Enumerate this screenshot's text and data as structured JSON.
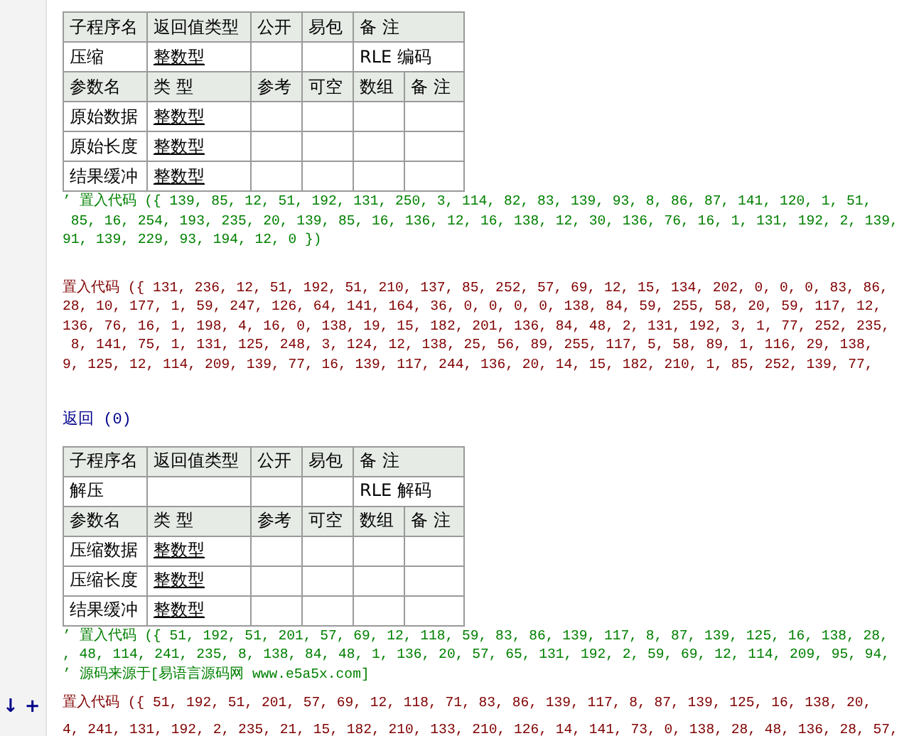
{
  "blocks": [
    {
      "kind": "table",
      "header": [
        "子程序名",
        "返回值类型",
        "公开",
        "易包",
        "备 注"
      ],
      "sub": {
        "name": "压缩",
        "return_type": "整数型",
        "remark": "RLE 编码"
      },
      "param_header": [
        "参数名",
        "类 型",
        "参考",
        "可空",
        "数组",
        "备 注"
      ],
      "params": [
        {
          "name": "原始数据",
          "type": "整数型"
        },
        {
          "name": "原始长度",
          "type": "整数型"
        },
        {
          "name": "结果缓冲",
          "type": "整数型"
        }
      ]
    },
    {
      "kind": "comment",
      "text": "’ 置入代码 ({ 139, 85, 12, 51, 192, 131, 250, 3, 114, 82, 83, 139, 93, 8, 86, 87, 141, 120, 1, 51,"
    },
    {
      "kind": "comment",
      "text": " 85, 16, 254, 193, 235, 20, 139, 85, 16, 136, 12, 16, 138, 12, 30, 136, 76, 16, 1, 131, 192, 2, 139,"
    },
    {
      "kind": "comment",
      "text": "91, 139, 229, 93, 194, 12, 0 })"
    },
    {
      "kind": "blank"
    },
    {
      "kind": "code",
      "text": "置入代码 ({ 131, 236, 12, 51, 192, 51, 210, 137, 85, 252, 57, 69, 12, 15, 134, 202, 0, 0, 0, 83, 86,"
    },
    {
      "kind": "code",
      "text": "28, 10, 177, 1, 59, 247, 126, 64, 141, 164, 36, 0, 0, 0, 0, 138, 84, 59, 255, 58, 20, 59, 117, 12,"
    },
    {
      "kind": "code",
      "text": "136, 76, 16, 1, 198, 4, 16, 0, 138, 19, 15, 182, 201, 136, 84, 48, 2, 131, 192, 3, 1, 77, 252, 235,"
    },
    {
      "kind": "code",
      "text": " 8, 141, 75, 1, 131, 125, 248, 3, 124, 12, 138, 25, 56, 89, 255, 117, 5, 58, 89, 1, 116, 29, 138,"
    },
    {
      "kind": "code",
      "text": "9, 125, 12, 114, 209, 139, 77, 16, 139, 117, 244, 136, 20, 14, 15, 182, 210, 1, 85, 252, 139, 77,"
    },
    {
      "kind": "blank"
    },
    {
      "kind": "return",
      "text": "返回 (0)"
    },
    {
      "kind": "table",
      "header": [
        "子程序名",
        "返回值类型",
        "公开",
        "易包",
        "备 注"
      ],
      "sub": {
        "name": "解压",
        "remark": "RLE 解码"
      },
      "param_header": [
        "参数名",
        "类 型",
        "参考",
        "可空",
        "数组",
        "备 注"
      ],
      "params": [
        {
          "name": "压缩数据",
          "type": "整数型"
        },
        {
          "name": "压缩长度",
          "type": "整数型"
        },
        {
          "name": "结果缓冲",
          "type": "整数型"
        }
      ]
    },
    {
      "kind": "comment",
      "text": "’ 置入代码 ({ 51, 192, 51, 201, 57, 69, 12, 118, 59, 83, 86, 139, 117, 8, 87, 139, 125, 16, 138, 28,"
    },
    {
      "kind": "comment",
      "text": ", 48, 114, 241, 235, 8, 138, 84, 48, 1, 136, 20, 57, 65, 131, 192, 2, 59, 69, 12, 114, 209, 95, 94,"
    },
    {
      "kind": "comment",
      "text": "’ 源码来源于[易语言源码网 www.e5a5x.com]"
    },
    {
      "kind": "code",
      "text": "置入代码 ({ 51, 192, 51, 201, 57, 69, 12, 118, 71, 83, 86, 139, 117, 8, 87, 139, 125, 16, 138, 20,",
      "gutter": "↓ +"
    },
    {
      "kind": "code",
      "text": "4, 241, 131, 192, 2, 235, 21, 15, 182, 210, 133, 210, 126, 14, 141, 73, 0, 138, 28, 48, 136, 28, 57,"
    }
  ]
}
